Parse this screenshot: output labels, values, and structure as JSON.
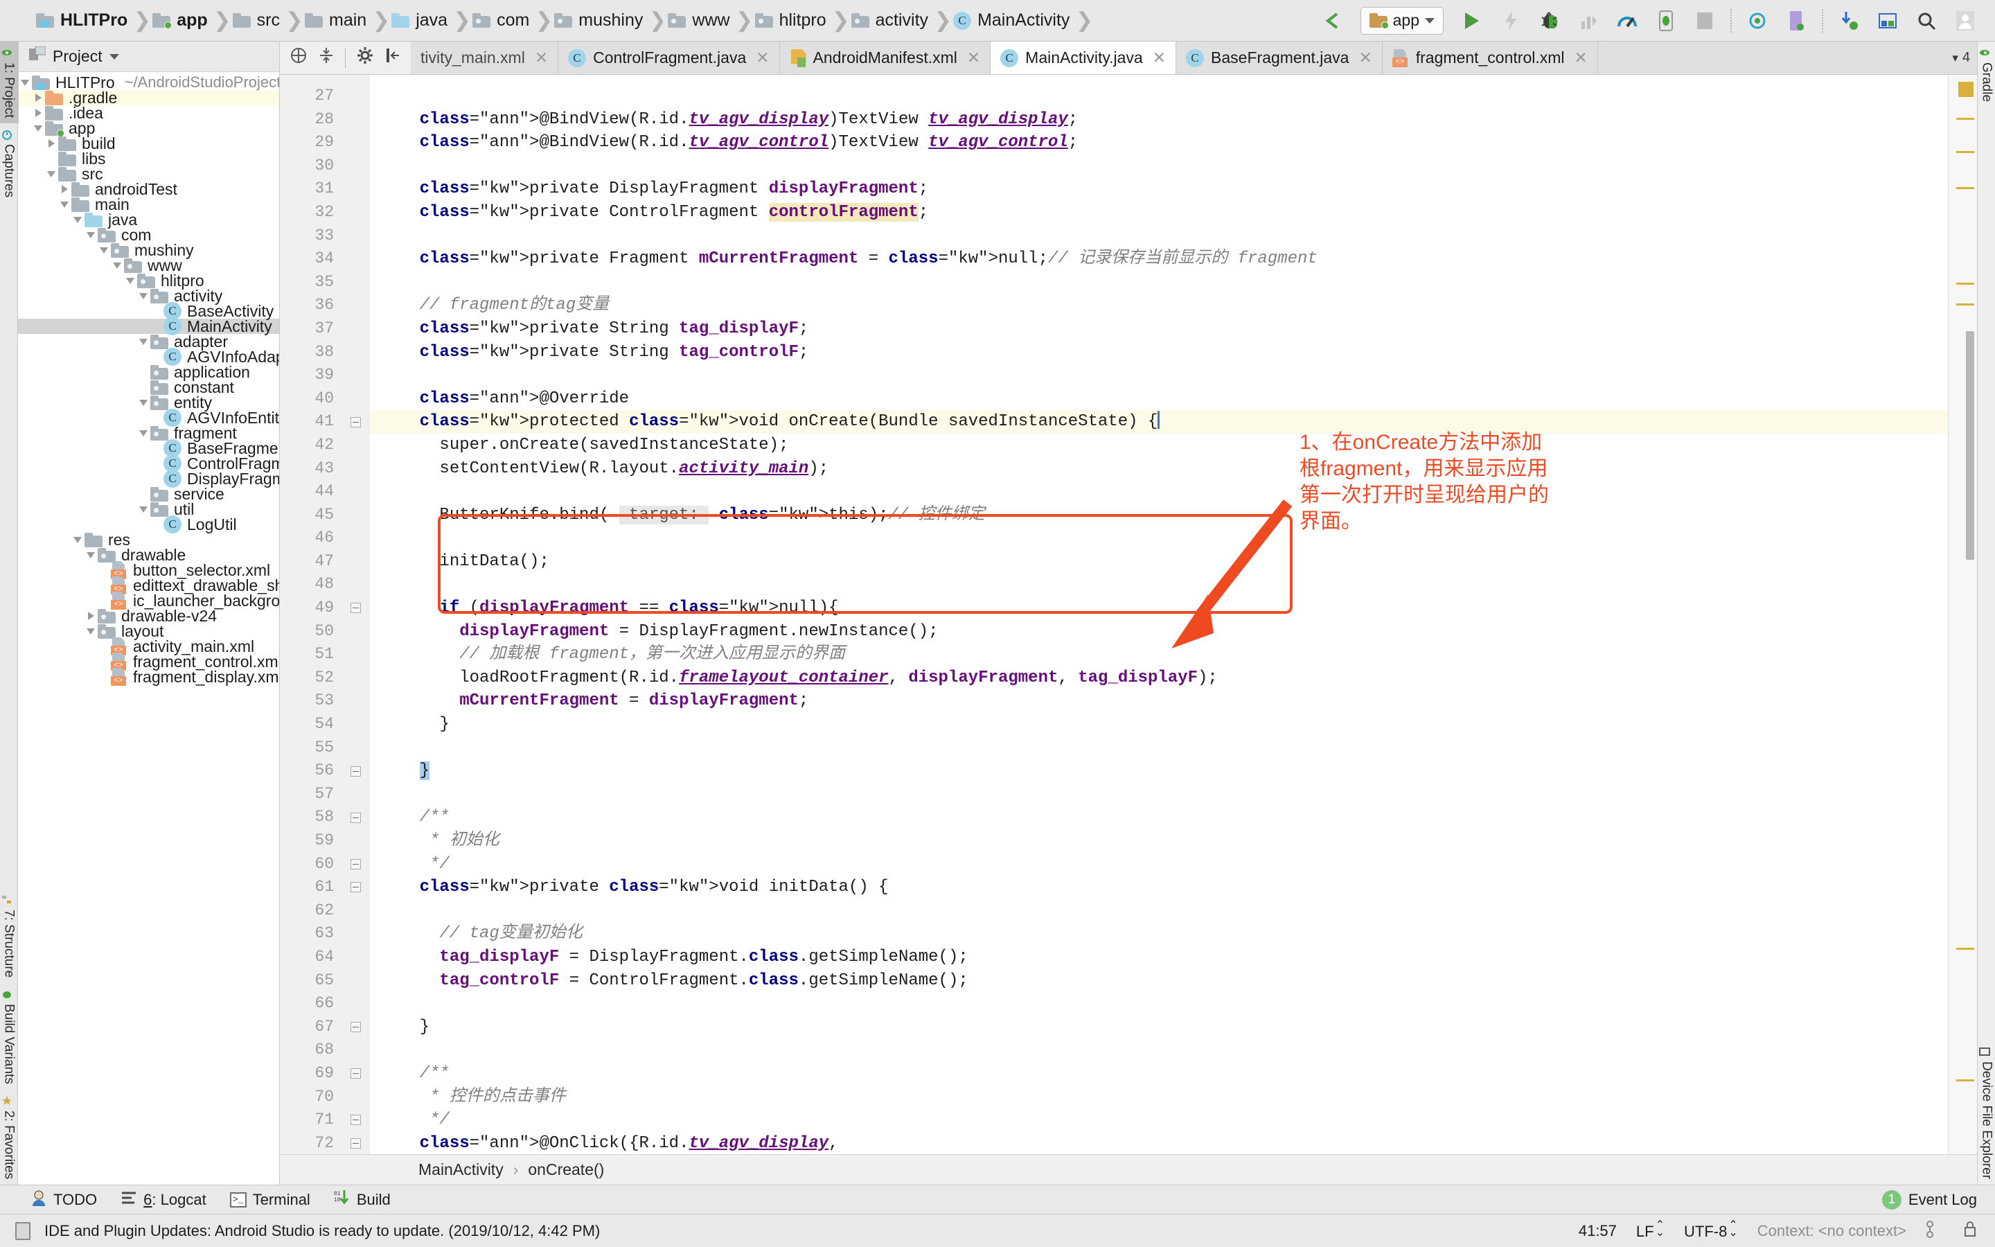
{
  "window": {
    "breadcrumb": [
      {
        "label": "HLITPro",
        "icon": "project-folder-icon",
        "bold": true
      },
      {
        "label": "app",
        "icon": "module-folder-icon",
        "bold": true
      },
      {
        "label": "src",
        "icon": "folder-icon",
        "bold": false
      },
      {
        "label": "main",
        "icon": "folder-icon",
        "bold": false
      },
      {
        "label": "java",
        "icon": "source-folder-icon",
        "bold": false
      },
      {
        "label": "com",
        "icon": "package-icon",
        "bold": false
      },
      {
        "label": "mushiny",
        "icon": "package-icon",
        "bold": false
      },
      {
        "label": "www",
        "icon": "package-icon",
        "bold": false
      },
      {
        "label": "hlitpro",
        "icon": "package-icon",
        "bold": false
      },
      {
        "label": "activity",
        "icon": "package-icon",
        "bold": false
      },
      {
        "label": "MainActivity",
        "icon": "java-class-icon",
        "bold": false
      }
    ],
    "toolbar": {
      "run_config": "app",
      "buttons": [
        "sync-project-icon",
        "run-button",
        "apply-changes-icon",
        "debug-button",
        "run-coverage-icon",
        "profiler-icon",
        "device-icon",
        "stop-button",
        "sync-gradle-icon",
        "avd-manager-icon",
        "sdk-manager-icon",
        "layout-inspector-icon",
        "search-everywhere-icon",
        "user-account-icon"
      ]
    }
  },
  "left_strip": {
    "tabs": [
      {
        "label": "1: Project",
        "active": true,
        "icon": "project-icon"
      },
      {
        "label": "Captures",
        "active": false,
        "icon": "captures-icon"
      }
    ],
    "bottom_tabs": [
      {
        "label": "7: Structure",
        "icon": "structure-icon"
      },
      {
        "label": "Build Variants",
        "icon": "build-variants-icon"
      },
      {
        "label": "2: Favorites",
        "icon": "favorites-star-icon"
      }
    ]
  },
  "right_strip": {
    "tabs": [
      {
        "label": "Gradle",
        "icon": "gradle-icon"
      },
      {
        "label": "Device File Explorer",
        "icon": "device-file-explorer-icon"
      }
    ]
  },
  "project_panel": {
    "title": "Project",
    "tree": [
      {
        "depth": 0,
        "label": "HLITPro",
        "path": "~/AndroidStudioProjects/HLITPro",
        "icon": "project-folder-icon",
        "twist": "open",
        "state": "normal"
      },
      {
        "depth": 1,
        "label": ".gradle",
        "icon": "gradle-folder-icon",
        "twist": "closed",
        "state": "highlight"
      },
      {
        "depth": 1,
        "label": ".idea",
        "icon": "folder-icon",
        "twist": "closed",
        "state": "normal"
      },
      {
        "depth": 1,
        "label": "app",
        "icon": "module-folder-icon",
        "twist": "open",
        "state": "normal"
      },
      {
        "depth": 2,
        "label": "build",
        "icon": "folder-icon",
        "twist": "closed",
        "state": "normal"
      },
      {
        "depth": 2,
        "label": "libs",
        "icon": "folder-icon",
        "twist": "none",
        "state": "normal"
      },
      {
        "depth": 2,
        "label": "src",
        "icon": "folder-icon",
        "twist": "open",
        "state": "normal"
      },
      {
        "depth": 3,
        "label": "androidTest",
        "icon": "folder-icon",
        "twist": "closed",
        "state": "normal"
      },
      {
        "depth": 3,
        "label": "main",
        "icon": "folder-icon",
        "twist": "open",
        "state": "normal"
      },
      {
        "depth": 4,
        "label": "java",
        "icon": "source-folder-icon",
        "twist": "open",
        "state": "normal"
      },
      {
        "depth": 5,
        "label": "com",
        "icon": "package-icon",
        "twist": "open",
        "state": "normal"
      },
      {
        "depth": 6,
        "label": "mushiny",
        "icon": "package-icon",
        "twist": "open",
        "state": "normal"
      },
      {
        "depth": 7,
        "label": "www",
        "icon": "package-icon",
        "twist": "open",
        "state": "normal"
      },
      {
        "depth": 8,
        "label": "hlitpro",
        "icon": "package-icon",
        "twist": "open",
        "state": "normal"
      },
      {
        "depth": 9,
        "label": "activity",
        "icon": "package-icon",
        "twist": "open",
        "state": "normal"
      },
      {
        "depth": 10,
        "label": "BaseActivity",
        "icon": "java-class-icon",
        "twist": "none",
        "state": "normal"
      },
      {
        "depth": 10,
        "label": "MainActivity",
        "icon": "java-class-icon",
        "twist": "none",
        "state": "selected"
      },
      {
        "depth": 9,
        "label": "adapter",
        "icon": "package-icon",
        "twist": "open",
        "state": "normal"
      },
      {
        "depth": 10,
        "label": "AGVInfoAdapter",
        "icon": "java-class-icon",
        "twist": "none",
        "state": "normal"
      },
      {
        "depth": 9,
        "label": "application",
        "icon": "package-icon",
        "twist": "none",
        "state": "normal"
      },
      {
        "depth": 9,
        "label": "constant",
        "icon": "package-icon",
        "twist": "none",
        "state": "normal"
      },
      {
        "depth": 9,
        "label": "entity",
        "icon": "package-icon",
        "twist": "open",
        "state": "normal"
      },
      {
        "depth": 10,
        "label": "AGVInfoEntity",
        "icon": "java-class-icon",
        "twist": "none",
        "state": "normal"
      },
      {
        "depth": 9,
        "label": "fragment",
        "icon": "package-icon",
        "twist": "open",
        "state": "normal"
      },
      {
        "depth": 10,
        "label": "BaseFragment",
        "icon": "java-class-icon",
        "twist": "none",
        "state": "normal"
      },
      {
        "depth": 10,
        "label": "ControlFragment",
        "icon": "java-class-icon",
        "twist": "none",
        "state": "normal"
      },
      {
        "depth": 10,
        "label": "DisplayFragment",
        "icon": "java-class-icon",
        "twist": "none",
        "state": "normal"
      },
      {
        "depth": 9,
        "label": "service",
        "icon": "package-icon",
        "twist": "none",
        "state": "normal"
      },
      {
        "depth": 9,
        "label": "util",
        "icon": "package-icon",
        "twist": "open",
        "state": "normal"
      },
      {
        "depth": 10,
        "label": "LogUtil",
        "icon": "java-class-icon",
        "twist": "none",
        "state": "normal"
      },
      {
        "depth": 4,
        "label": "res",
        "icon": "res-folder-icon",
        "twist": "open",
        "state": "normal"
      },
      {
        "depth": 5,
        "label": "drawable",
        "icon": "package-icon",
        "twist": "open",
        "state": "normal"
      },
      {
        "depth": 6,
        "label": "button_selector.xml",
        "icon": "xml-file-icon",
        "twist": "none",
        "state": "normal"
      },
      {
        "depth": 6,
        "label": "edittext_drawable_shape.xml",
        "icon": "xml-file-icon",
        "twist": "none",
        "state": "normal"
      },
      {
        "depth": 6,
        "label": "ic_launcher_background.xml",
        "icon": "xml-file-icon",
        "twist": "none",
        "state": "normal"
      },
      {
        "depth": 5,
        "label": "drawable-v24",
        "icon": "package-icon",
        "twist": "closed",
        "state": "normal"
      },
      {
        "depth": 5,
        "label": "layout",
        "icon": "package-icon",
        "twist": "open",
        "state": "normal"
      },
      {
        "depth": 6,
        "label": "activity_main.xml",
        "icon": "xml-file-icon",
        "twist": "none",
        "state": "normal"
      },
      {
        "depth": 6,
        "label": "fragment_control.xml",
        "icon": "xml-file-icon",
        "twist": "none",
        "state": "normal"
      },
      {
        "depth": 6,
        "label": "fragment_display.xml",
        "icon": "xml-file-icon",
        "twist": "none",
        "state": "normal"
      }
    ]
  },
  "editor": {
    "tabs": [
      {
        "label": "tivity_main.xml",
        "icon": "xml-file-icon",
        "active": false,
        "clipped": true
      },
      {
        "label": "ControlFragment.java",
        "icon": "java-class-icon",
        "active": false
      },
      {
        "label": "AndroidManifest.xml",
        "icon": "manifest-file-icon",
        "active": false
      },
      {
        "label": "MainActivity.java",
        "icon": "java-class-icon",
        "active": true
      },
      {
        "label": "BaseFragment.java",
        "icon": "java-class-icon",
        "active": false
      },
      {
        "label": "fragment_control.xml",
        "icon": "xml-file-icon",
        "active": false
      }
    ],
    "tab_overflow": "4",
    "first_line_number": 27,
    "breadcrumb": [
      "MainActivity",
      "onCreate()"
    ],
    "lines": [
      {
        "n": 27,
        "text": ""
      },
      {
        "n": 28,
        "text": "@BindView(R.id.tv_agv_display)TextView tv_agv_display;"
      },
      {
        "n": 29,
        "text": "@BindView(R.id.tv_agv_control)TextView tv_agv_control;"
      },
      {
        "n": 30,
        "text": ""
      },
      {
        "n": 31,
        "text": "private DisplayFragment displayFragment;"
      },
      {
        "n": 32,
        "text": "private ControlFragment controlFragment;"
      },
      {
        "n": 33,
        "text": ""
      },
      {
        "n": 34,
        "text": "private Fragment mCurrentFragment = null;// 记录保存当前显示的 fragment"
      },
      {
        "n": 35,
        "text": ""
      },
      {
        "n": 36,
        "text": "// fragment的tag变量"
      },
      {
        "n": 37,
        "text": "private String tag_displayF;"
      },
      {
        "n": 38,
        "text": "private String tag_controlF;"
      },
      {
        "n": 39,
        "text": ""
      },
      {
        "n": 40,
        "text": "@Override"
      },
      {
        "n": 41,
        "text": "protected void onCreate(Bundle savedInstanceState) {"
      },
      {
        "n": 42,
        "text": "super.onCreate(savedInstanceState);"
      },
      {
        "n": 43,
        "text": "setContentView(R.layout.activity_main);"
      },
      {
        "n": 44,
        "text": ""
      },
      {
        "n": 45,
        "text": "ButterKnife.bind( target: this);// 控件绑定"
      },
      {
        "n": 46,
        "text": ""
      },
      {
        "n": 47,
        "text": "initData();"
      },
      {
        "n": 48,
        "text": ""
      },
      {
        "n": 49,
        "text": "if (displayFragment == null){"
      },
      {
        "n": 50,
        "text": "displayFragment = DisplayFragment.newInstance();"
      },
      {
        "n": 51,
        "text": "// 加载根 fragment，第一次进入应用显示的界面"
      },
      {
        "n": 52,
        "text": "loadRootFragment(R.id.framelayout_container, displayFragment, tag_displayF);"
      },
      {
        "n": 53,
        "text": "mCurrentFragment = displayFragment;"
      },
      {
        "n": 54,
        "text": "}"
      },
      {
        "n": 55,
        "text": ""
      },
      {
        "n": 56,
        "text": "}"
      },
      {
        "n": 57,
        "text": ""
      },
      {
        "n": 58,
        "text": "/**"
      },
      {
        "n": 59,
        "text": " * 初始化"
      },
      {
        "n": 60,
        "text": " */"
      },
      {
        "n": 61,
        "text": "private void initData() {"
      },
      {
        "n": 62,
        "text": ""
      },
      {
        "n": 63,
        "text": "// tag变量初始化"
      },
      {
        "n": 64,
        "text": "tag_displayF = DisplayFragment.class.getSimpleName();"
      },
      {
        "n": 65,
        "text": "tag_controlF = ControlFragment.class.getSimpleName();"
      },
      {
        "n": 66,
        "text": ""
      },
      {
        "n": 67,
        "text": "}"
      },
      {
        "n": 68,
        "text": ""
      },
      {
        "n": 69,
        "text": "/**"
      },
      {
        "n": 70,
        "text": " * 控件的点击事件"
      },
      {
        "n": 71,
        "text": " */"
      },
      {
        "n": 72,
        "text": "@OnClick({R.id.tv_agv_display,"
      }
    ]
  },
  "annotation": {
    "text": "1、在onCreate方法中添加根fragment，用来显示应用第一次打开时呈现给用户的界面。",
    "color": "#f04a23"
  },
  "bottom": {
    "tool_windows": [
      {
        "label": "TODO",
        "icon": "todo-icon",
        "mnemonic": ""
      },
      {
        "label": ": Logcat",
        "icon": "logcat-icon",
        "mnemonic": "6"
      },
      {
        "label": "Terminal",
        "icon": "terminal-icon",
        "mnemonic": ""
      },
      {
        "label": "Build",
        "icon": "build-icon",
        "mnemonic": ""
      }
    ],
    "event_log": {
      "label": "Event Log",
      "count": "1"
    },
    "status_message": "IDE and Plugin Updates: Android Studio is ready to update. (2019/10/12, 4:42 PM)",
    "caret_position": "41:57",
    "line_separator": "LF",
    "encoding": "UTF-8",
    "context": "Context: <no context>"
  }
}
